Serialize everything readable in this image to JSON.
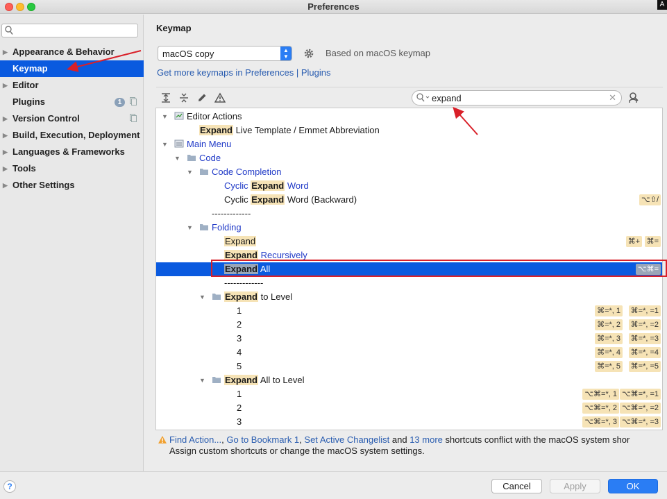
{
  "window": {
    "title": "Preferences",
    "corner_badge": "A"
  },
  "sidebar": {
    "search_placeholder": "",
    "items": [
      {
        "label": "Appearance & Behavior",
        "arrow": "▶"
      },
      {
        "label": "Keymap",
        "arrow": ""
      },
      {
        "label": "Editor",
        "arrow": "▶"
      },
      {
        "label": "Plugins",
        "arrow": "",
        "badge": "1"
      },
      {
        "label": "Version Control",
        "arrow": "▶"
      },
      {
        "label": "Build, Execution, Deployment",
        "arrow": "▶"
      },
      {
        "label": "Languages & Frameworks",
        "arrow": "▶"
      },
      {
        "label": "Tools",
        "arrow": "▶"
      },
      {
        "label": "Other Settings",
        "arrow": "▶"
      }
    ]
  },
  "main": {
    "heading": "Keymap",
    "keymap_select": "macOS copy",
    "based_on": "Based on macOS keymap",
    "more_link": "Get more keymaps in Preferences | Plugins",
    "filter_value": "expand"
  },
  "tree": {
    "editor_actions": "Editor Actions",
    "r1_hl": "Expand",
    "r1_rest": " Live Template / Emmet Abbreviation",
    "main_menu": "Main Menu",
    "code": "Code",
    "code_completion": "Code Completion",
    "r_cyc1_pre": "Cyclic ",
    "r_cyc1_hl": "Expand",
    "r_cyc1_post": " Word",
    "r_cyc2_pre": "Cyclic ",
    "r_cyc2_hl": "Expand",
    "r_cyc2_post": " Word (Backward)",
    "r_cyc2_sc": "⌥⇧/",
    "separator1": "-------------",
    "folding": "Folding",
    "r_exp_hl": "Expand",
    "r_exp_sc1": "⌘+",
    "r_exp_sc2": "⌘=",
    "r_exprec_hl": "Expand",
    "r_exprec_post": " Recursively",
    "r_expall_hl": "Expand",
    "r_expall_post": " All",
    "r_expall_sc": "⌥⌘=",
    "separator2": "-------------",
    "r_lvl_hl": "Expand",
    "r_lvl_post": " to Level",
    "levels": [
      {
        "n": "1",
        "sc1": "⌘=*, 1",
        "sc2": "⌘=*, =1"
      },
      {
        "n": "2",
        "sc1": "⌘=*, 2",
        "sc2": "⌘=*, =2"
      },
      {
        "n": "3",
        "sc1": "⌘=*, 3",
        "sc2": "⌘=*, =3"
      },
      {
        "n": "4",
        "sc1": "⌘=*, 4",
        "sc2": "⌘=*, =4"
      },
      {
        "n": "5",
        "sc1": "⌘=*, 5",
        "sc2": "⌘=*, =5"
      }
    ],
    "r_alllvl_hl": "Expand",
    "r_alllvl_post": " All to Level",
    "all_levels": [
      {
        "n": "1",
        "sc1": "⌥⌘=*, 1",
        "sc2": "⌥⌘=*, =1"
      },
      {
        "n": "2",
        "sc1": "⌥⌘=*, 2",
        "sc2": "⌥⌘=*, =2"
      },
      {
        "n": "3",
        "sc1": "⌥⌘=*, 3",
        "sc2": "⌥⌘=*, =3"
      }
    ]
  },
  "warning": {
    "link1": "Find Action...",
    "sep1": ", ",
    "link2": "Go to Bookmark 1",
    "sep2": ", ",
    "link3": "Set Active Changelist",
    "and": " and ",
    "link4": "13 more",
    "rest": " shortcuts conflict with the macOS system shor",
    "line2": "Assign custom shortcuts or change the macOS system settings."
  },
  "footer": {
    "help": "?",
    "cancel": "Cancel",
    "apply": "Apply",
    "ok": "OK"
  },
  "colors": {
    "accent": "#0a5adf",
    "highlight": "#f6e3b6",
    "annotation": "#d92029"
  }
}
